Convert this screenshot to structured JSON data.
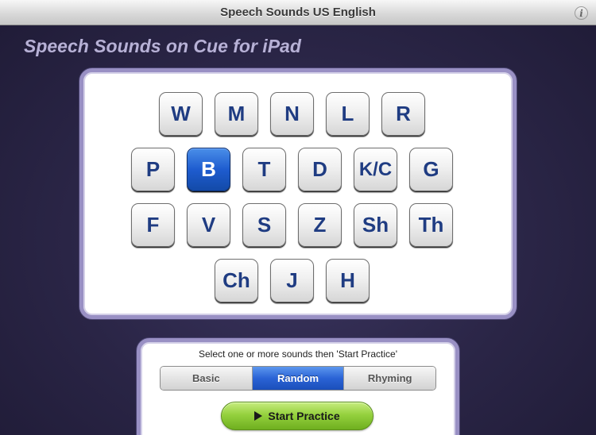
{
  "window": {
    "title": "Speech Sounds US English",
    "info_icon": "info-icon",
    "info_glyph": "i"
  },
  "app": {
    "heading": "Speech Sounds on Cue for iPad"
  },
  "letters": {
    "rows": [
      [
        "W",
        "M",
        "N",
        "L",
        "R"
      ],
      [
        "P",
        "B",
        "T",
        "D",
        "K/C",
        "G"
      ],
      [
        "F",
        "V",
        "S",
        "Z",
        "Sh",
        "Th"
      ],
      [
        "Ch",
        "J",
        "H"
      ]
    ],
    "selected": "B"
  },
  "controls": {
    "instruction": "Select one or more sounds then 'Start Practice'",
    "modes": [
      "Basic",
      "Random",
      "Rhyming"
    ],
    "active_mode": "Random",
    "start_label": "Start Practice",
    "start_icon": "play-icon"
  },
  "colors": {
    "accent_blue": "#2a63d6",
    "start_green": "#95d13e",
    "letter_text": "#1f3c82",
    "panel_border": "#9990c4",
    "background": "#2a2546"
  }
}
